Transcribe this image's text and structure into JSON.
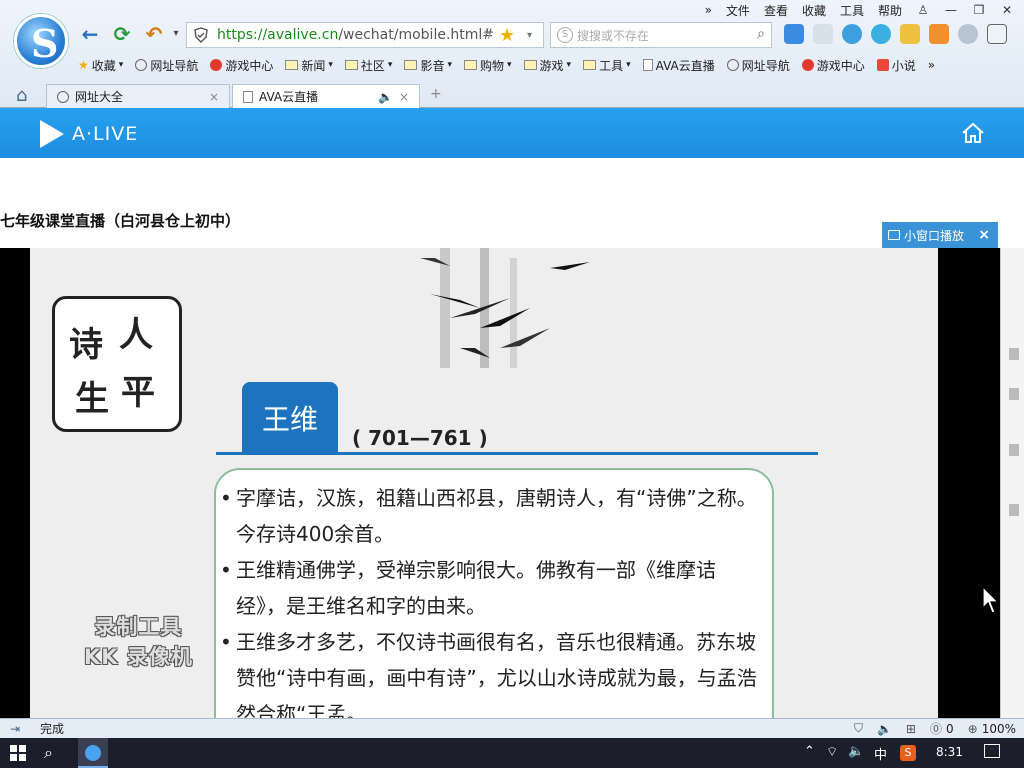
{
  "menu": {
    "file": "文件",
    "view": "查看",
    "favorites": "收藏",
    "tools": "工具",
    "help": "帮助"
  },
  "address": {
    "url_green": "https://avalive.cn",
    "url_rest": "/wechat/mobile.html#"
  },
  "search": {
    "placeholder": "搜搜或不存在"
  },
  "favbar": {
    "items": [
      "收藏",
      "网址导航",
      "游戏中心",
      "新闻",
      "社区",
      "影音",
      "购物",
      "游戏",
      "工具",
      "AVA云直播",
      "网址导航",
      "游戏中心",
      "小说"
    ]
  },
  "tabs": [
    {
      "label": "网址大全"
    },
    {
      "label": "AVA云直播"
    }
  ],
  "app": {
    "logo_text": "A·LIVE"
  },
  "page": {
    "title": "七年级课堂直播（白河县仓上初中）",
    "mini_player": "小窗口播放"
  },
  "slide": {
    "box_chars": [
      "诗",
      "人",
      "生",
      "平"
    ],
    "poet_name": "王维",
    "years": "( 701—761 )",
    "bullets": [
      "字摩诘，汉族，祖籍山西祁县，唐朝诗人，有“诗佛”之称。今存诗400余首。",
      "王维精通佛学，受禅宗影响很大。佛教有一部《维摩诘经》，是王维名和字的由来。",
      "王维多才多艺，不仅诗书画很有名，音乐也很精通。苏东坡赞他“诗中有画，画中有诗”，尤以山水诗成就为最，与孟浩然合称“王孟。"
    ],
    "watermark_line1": "录制工具",
    "watermark_line2": "KK 录像机"
  },
  "statusbar": {
    "status": "完成",
    "count": "0",
    "zoom": "100%"
  },
  "taskbar": {
    "ime": "中",
    "time": "8:31"
  }
}
